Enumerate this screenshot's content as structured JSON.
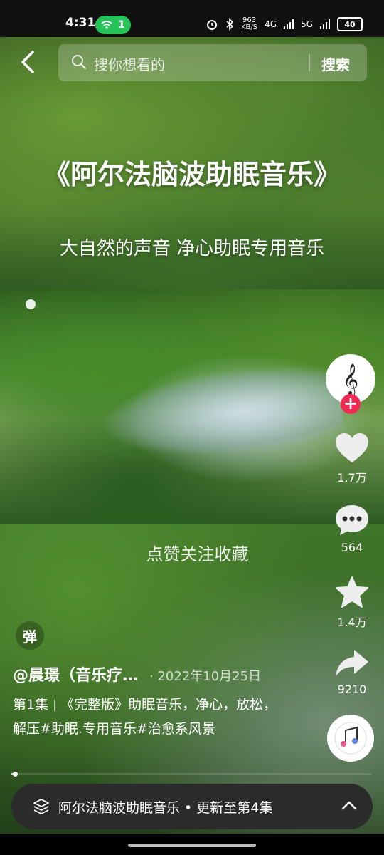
{
  "status_bar": {
    "time": "4:31",
    "hotspot_count": "1",
    "net_speed_top": "963",
    "net_speed_bottom": "KB/S",
    "signal1": "4G",
    "signal2": "5G",
    "battery": "40",
    "icons": [
      "alarm-icon",
      "bluetooth-icon",
      "signal-icon",
      "battery-icon"
    ]
  },
  "header": {
    "search_placeholder": "搜你想看的",
    "search_button": "搜索"
  },
  "video": {
    "title": "《阿尔法脑波助眠音乐》",
    "subtitle": "大自然的声音 净心助眠专用音乐",
    "mid_caption": "点赞关注收藏",
    "danmu_label": "弹",
    "progress_fraction": 0.01
  },
  "actions": {
    "likes": "1.7万",
    "comments": "564",
    "favorites": "1.4万",
    "shares": "9210"
  },
  "post": {
    "author": "@晨璟（音乐疗…",
    "date": "· 2022年10月25日",
    "episode": "第1集",
    "description": "《完整版》助眠音乐，净心，放松，解压#助眠.专用音乐#治愈系风景"
  },
  "collection": {
    "text": "阿尔法脑波助眠音乐 • 更新至第4集"
  },
  "colors": {
    "follow_plus": "#f02b54",
    "hotspot_pill": "#27c25a",
    "collection_bar": "#2b2b2b"
  }
}
